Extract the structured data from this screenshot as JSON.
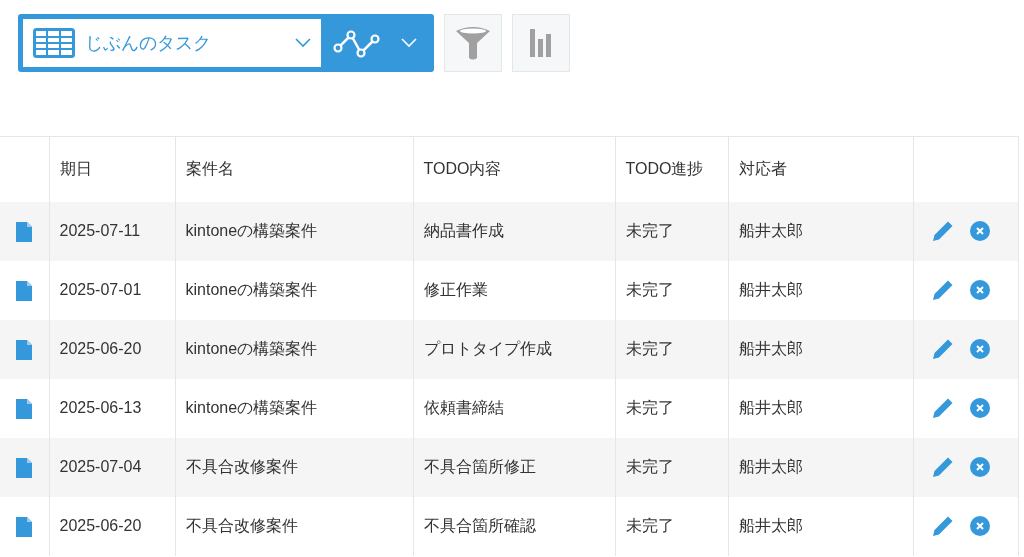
{
  "view_selector": {
    "value": "じぶんのタスク"
  },
  "table": {
    "columns": [
      "期日",
      "案件名",
      "TODO内容",
      "TODO進捗",
      "対応者"
    ],
    "rows": [
      {
        "cells": [
          "2025-07-11",
          "kintoneの構築案件",
          "納品書作成",
          "未完了",
          "船井太郎"
        ]
      },
      {
        "cells": [
          "2025-07-01",
          "kintoneの構築案件",
          "修正作業",
          "未完了",
          "船井太郎"
        ]
      },
      {
        "cells": [
          "2025-06-20",
          "kintoneの構築案件",
          "プロトタイプ作成",
          "未完了",
          "船井太郎"
        ]
      },
      {
        "cells": [
          "2025-06-13",
          "kintoneの構築案件",
          "依頼書締結",
          "未完了",
          "船井太郎"
        ]
      },
      {
        "cells": [
          "2025-07-04",
          "不具合改修案件",
          "不具合箇所修正",
          "未完了",
          "船井太郎"
        ]
      },
      {
        "cells": [
          "2025-06-20",
          "不具合改修案件",
          "不具合箇所確認",
          "未完了",
          "船井太郎"
        ]
      }
    ]
  }
}
